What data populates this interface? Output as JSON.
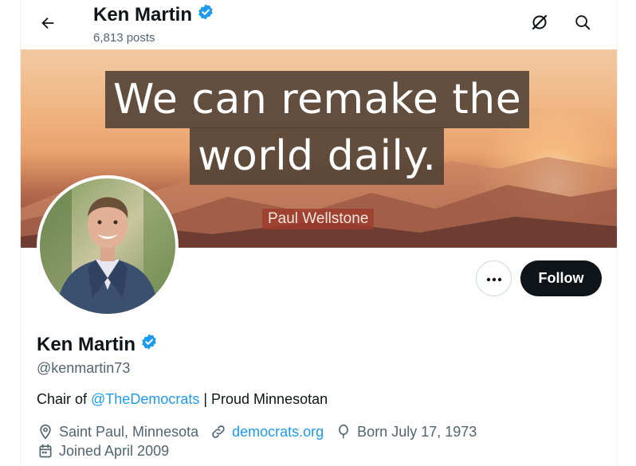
{
  "header": {
    "name": "Ken Martin",
    "posts_count": "6,813 posts",
    "icons": {
      "back": "arrow-left-icon",
      "grok": "grok-icon",
      "search": "search-icon",
      "verified": "verified-badge-icon"
    }
  },
  "banner": {
    "quote_line1": "We can remake the",
    "quote_line2": "world daily.",
    "author": "Paul Wellstone"
  },
  "actions": {
    "more_icon": "more-dots-icon",
    "follow_label": "Follow"
  },
  "profile": {
    "display_name": "Ken Martin",
    "handle": "@kenmartin73",
    "bio": {
      "prefix": "Chair of ",
      "mention": "@TheDemocrats",
      "suffix": " | Proud Minnesotan"
    },
    "location": "Saint Paul, Minnesota",
    "website": "democrats.org",
    "birthday": "Born July 17, 1973",
    "joined": "Joined April 2009"
  },
  "colors": {
    "text": "#0f1419",
    "secondary": "#536471",
    "link": "#1d9bf0",
    "follow_bg": "#0f1419",
    "verified": "#1d9bf0"
  }
}
